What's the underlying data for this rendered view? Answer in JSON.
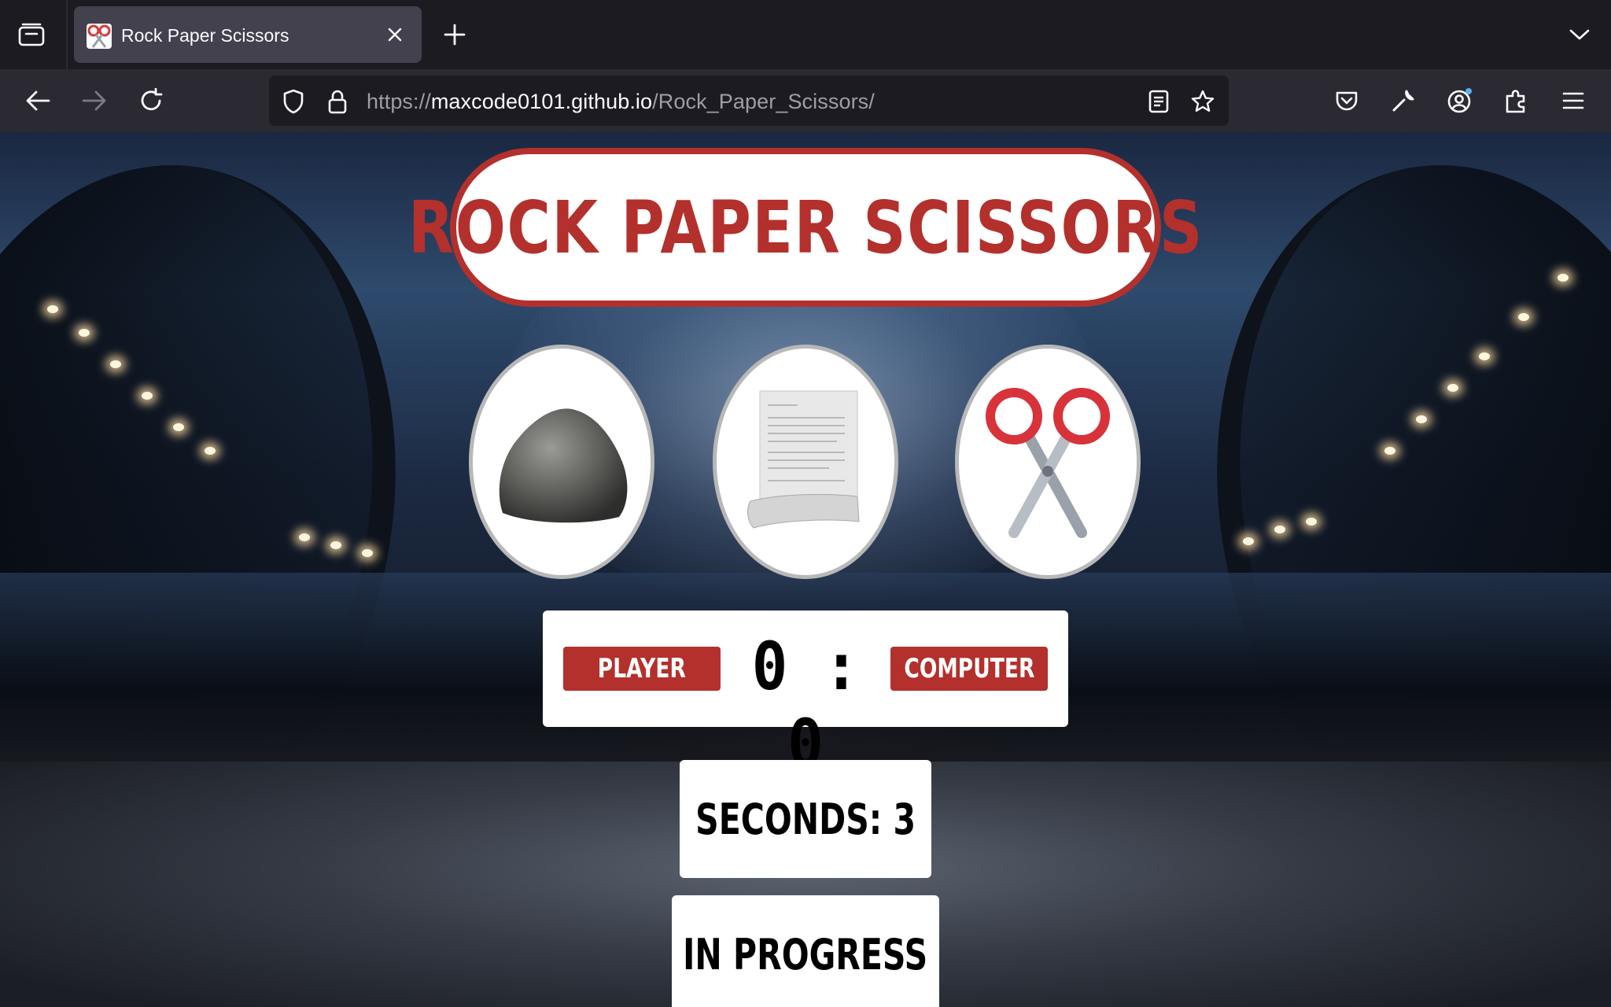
{
  "browser": {
    "tab_title": "Rock Paper Scissors",
    "url_scheme": "https://",
    "url_host": "maxcode0101.github.io",
    "url_path": "/Rock_Paper_Scissors/"
  },
  "game": {
    "title": "ROCK PAPER SCISSORS",
    "choices": [
      {
        "name": "rock",
        "icon": "rock-icon"
      },
      {
        "name": "paper",
        "icon": "paper-icon"
      },
      {
        "name": "scissors",
        "icon": "scissors-icon"
      }
    ],
    "scoreboard": {
      "player_label": "PLAYER",
      "computer_label": "COMPUTER",
      "score": "0 : 0"
    },
    "timer_text": "SECONDS: 3",
    "status_text": "IN PROGRESS"
  },
  "colors": {
    "accent_red": "#b3302c",
    "chrome_dark": "#1c1b22",
    "chrome_tab": "#42414d"
  }
}
